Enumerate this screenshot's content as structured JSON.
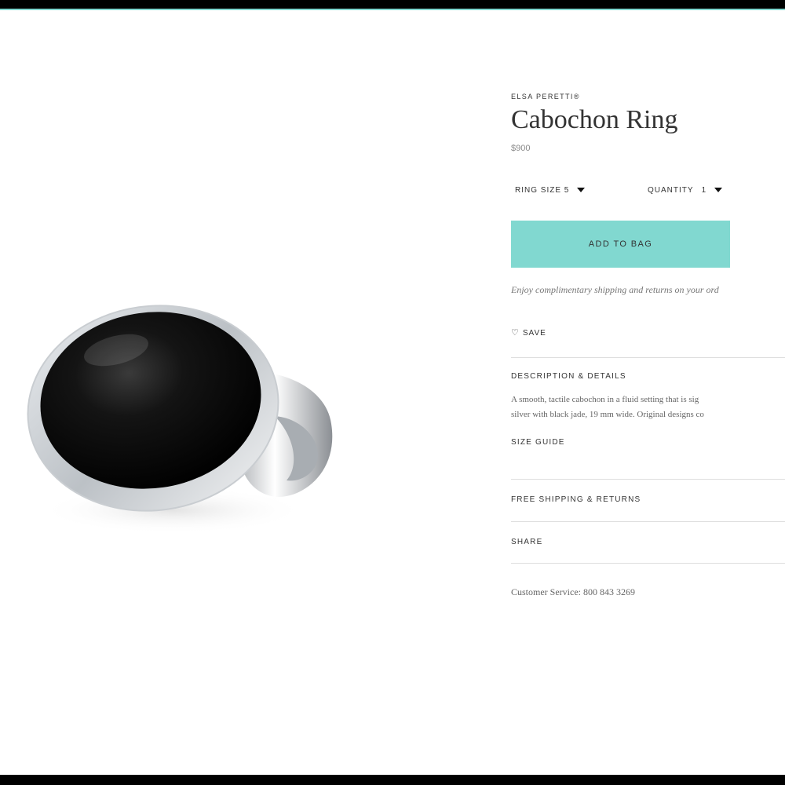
{
  "product": {
    "designer": "ELSA PERETTI®",
    "name": "Cabochon Ring",
    "price": "$900"
  },
  "options": {
    "ring_size_label": "RING SIZE 5",
    "quantity_label": "QUANTITY",
    "quantity_value": "1"
  },
  "actions": {
    "add_to_bag": "ADD TO BAG",
    "save": "SAVE"
  },
  "shipping_note": "Enjoy complimentary shipping and returns on your ord",
  "sections": {
    "description_title": "DESCRIPTION & DETAILS",
    "description_line1": "A smooth, tactile cabochon in a fluid setting that is sig",
    "description_line2": "silver with black jade, 19 mm wide. Original designs co",
    "size_guide": "SIZE GUIDE",
    "free_shipping": "FREE SHIPPING & RETURNS",
    "share": "SHARE"
  },
  "customer_service": "Customer Service: 800 843 3269",
  "colors": {
    "accent": "#81d8d0",
    "frame": "#000000",
    "text": "#333333"
  }
}
